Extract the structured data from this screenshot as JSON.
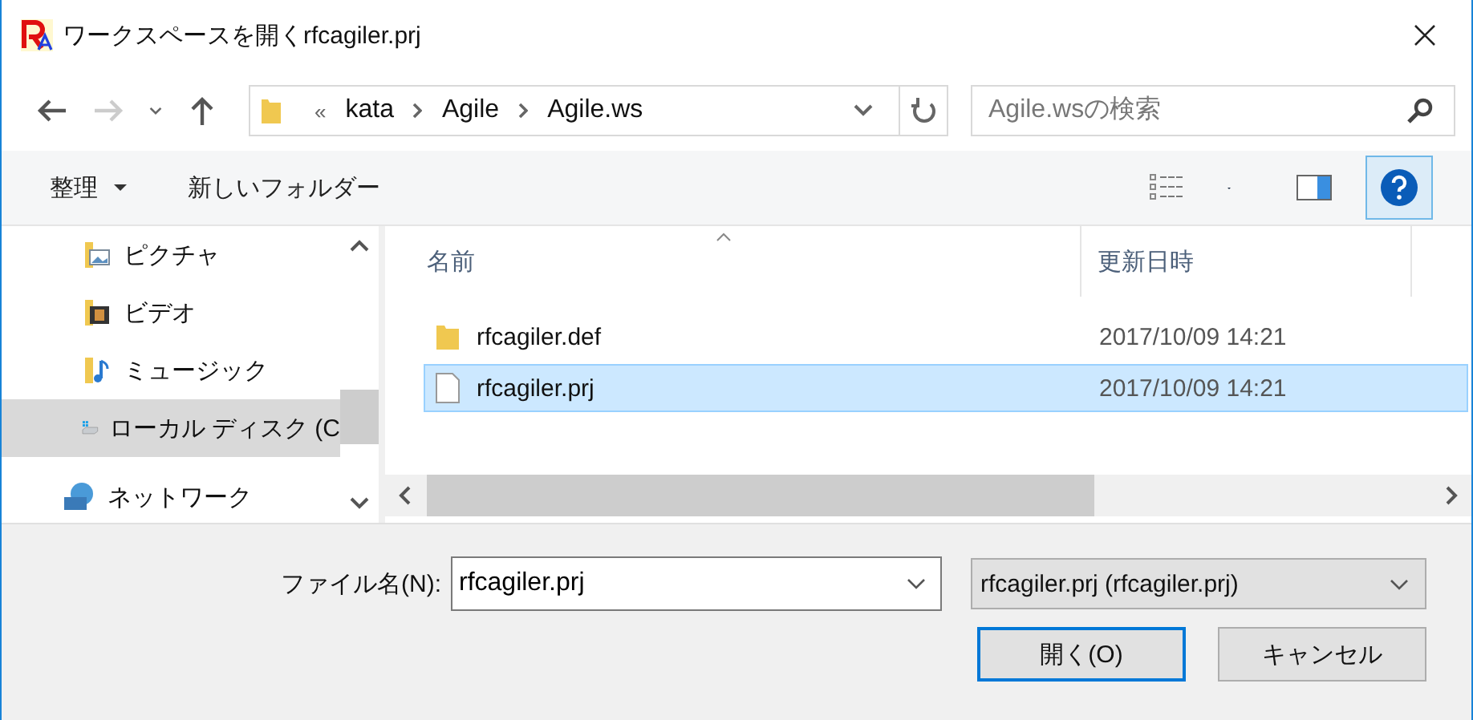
{
  "window": {
    "title": "ワークスペースを開くrfcagiler.prj"
  },
  "nav": {
    "back_disabled": false,
    "forward_disabled": true,
    "breadcrumb_prefix": "«",
    "path": [
      "kata",
      "Agile",
      "Agile.ws"
    ],
    "search": {
      "placeholder": "Agile.wsの検索"
    }
  },
  "toolbar": {
    "organize": "整理",
    "new_folder": "新しいフォルダー"
  },
  "sidebar": {
    "items": [
      {
        "label": "ピクチャ",
        "kind": "pictures",
        "selected": false
      },
      {
        "label": "ビデオ",
        "kind": "videos",
        "selected": false
      },
      {
        "label": "ミュージック",
        "kind": "music",
        "selected": false
      },
      {
        "label": "ローカル ディスク (C",
        "kind": "drive",
        "selected": true
      },
      {
        "label": "ネットワーク",
        "kind": "network",
        "selected": false
      }
    ]
  },
  "table": {
    "columns": [
      "名前",
      "更新日時"
    ],
    "rows": [
      {
        "name": "rfcagiler.def",
        "modified": "2017/10/09 14:21",
        "kind": "folder",
        "selected": false
      },
      {
        "name": "rfcagiler.prj",
        "modified": "2017/10/09 14:21",
        "kind": "file",
        "selected": true
      }
    ]
  },
  "footer": {
    "filename_label": "ファイル名(N):",
    "filename": "rfcagiler.prj",
    "filter": "rfcagiler.prj (rfcagiler.prj)",
    "buttons": [
      {
        "label": "開く(O)",
        "kind": "primary"
      },
      {
        "label": "キャンセル",
        "kind": "normal"
      }
    ]
  }
}
